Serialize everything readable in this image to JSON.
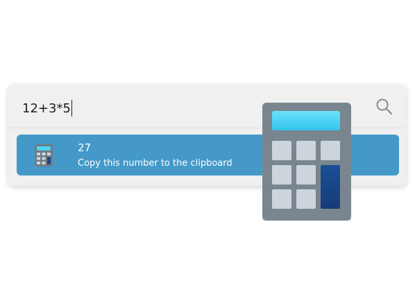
{
  "search": {
    "query": "12+3*5",
    "icon": "search-icon"
  },
  "result": {
    "title": "27",
    "subtitle": "Copy this number to the clipboard",
    "icon": "calculator-icon"
  },
  "colors": {
    "panel_bg": "#f0f0f0",
    "result_bg": "#4499c9",
    "result_text": "#ffffff",
    "calc_body": "#7a868f",
    "calc_screen": "#4fd3f5",
    "calc_key": "#cdd5dc",
    "calc_equals": "#1a4587"
  }
}
